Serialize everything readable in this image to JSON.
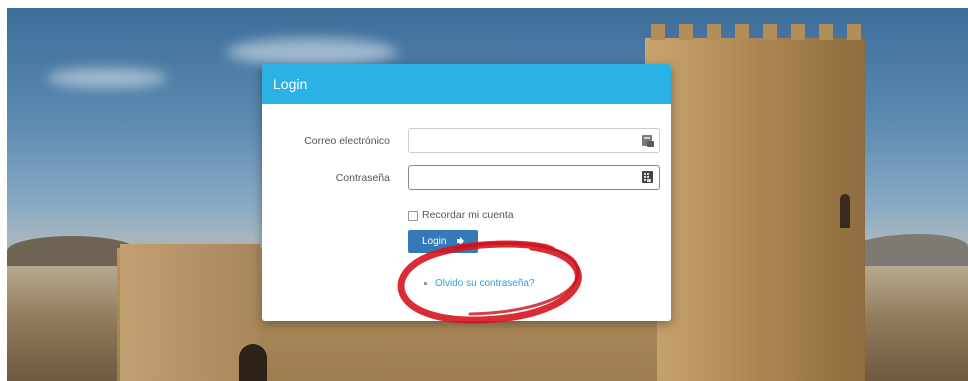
{
  "login": {
    "title": "Login",
    "email": {
      "label": "Correo electrónico",
      "value": "",
      "placeholder": ""
    },
    "password": {
      "label": "Contraseña",
      "value": "",
      "placeholder": ""
    },
    "remember": {
      "label": "Recordar mi cuenta",
      "checked": false
    },
    "submit_label": "Login",
    "forgot_label": "Olvido su contraseña?"
  },
  "icons": {
    "email_field": "contact-card-icon",
    "password_field": "keypad-icon",
    "submit": "sign-in-icon"
  },
  "colors": {
    "header": "#29b2e3",
    "button": "#337ab7",
    "link": "#2a9fd6",
    "annotation": "#d6151e"
  }
}
